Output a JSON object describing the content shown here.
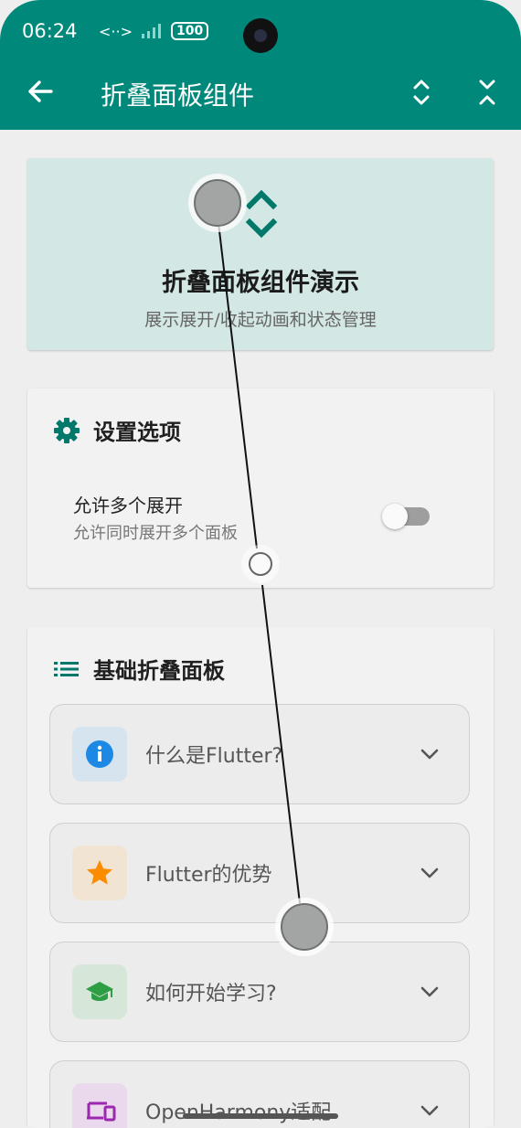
{
  "status": {
    "time": "06:24",
    "network": "<··>",
    "battery": "100"
  },
  "appbar": {
    "title": "折叠面板组件"
  },
  "hero": {
    "title": "折叠面板组件演示",
    "subtitle": "展示展开/收起动画和状态管理"
  },
  "settings": {
    "title": "设置选项",
    "option_title": "允许多个展开",
    "option_subtitle": "允许同时展开多个面板",
    "toggle_on": false
  },
  "basics": {
    "title": "基础折叠面板",
    "panels": [
      {
        "label": "什么是Flutter?",
        "icon": "info-icon",
        "color": "#1e88e5",
        "bg": "#d6e4ef"
      },
      {
        "label": "Flutter的优势",
        "icon": "star-icon",
        "color": "#fb8c00",
        "bg": "#f2e4d3"
      },
      {
        "label": "如何开始学习?",
        "icon": "school-icon",
        "color": "#2e9e44",
        "bg": "#d6e7da"
      },
      {
        "label": "OpenHarmony适配",
        "icon": "devices-icon",
        "color": "#9c27b0",
        "bg": "#ead8ec"
      }
    ]
  },
  "colors": {
    "primary": "#00897b",
    "hero_bg": "#d3e7e4",
    "accent_icon": "#00796b"
  }
}
